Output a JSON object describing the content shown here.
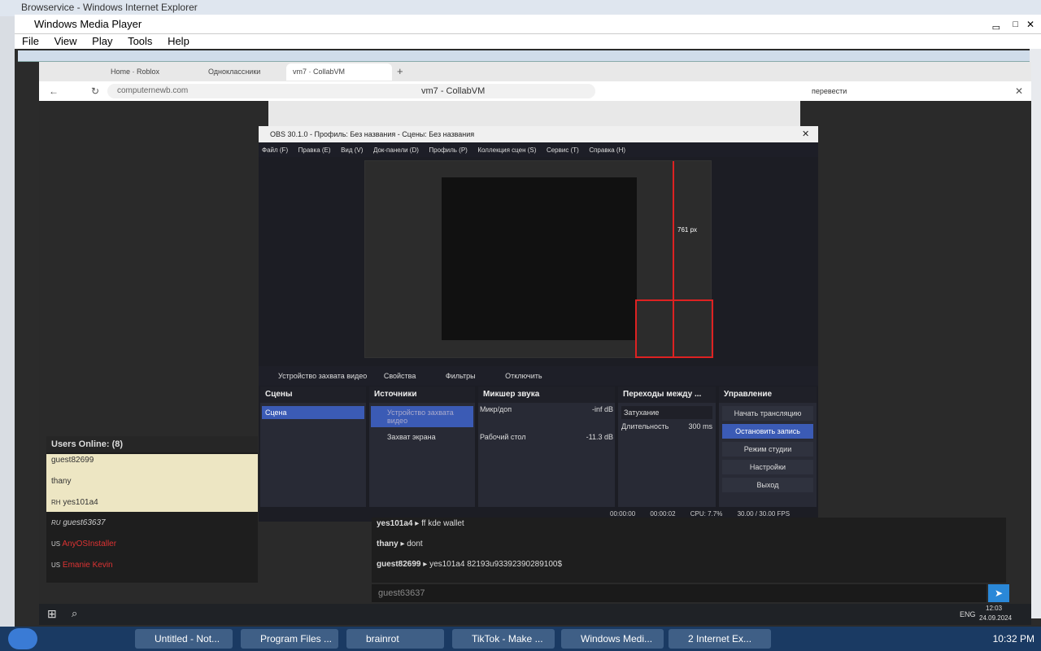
{
  "ie": {
    "title": "Browservice - Windows Internet Explorer"
  },
  "wmp": {
    "title": "Windows Media Player",
    "menu": [
      "File",
      "View",
      "Play",
      "Tools",
      "Help"
    ]
  },
  "browser": {
    "tabs": [
      {
        "label": "Home · Roblox"
      },
      {
        "label": "Одноклассники"
      },
      {
        "label": "vm7 · CollabVM"
      }
    ],
    "url": "computernewb.com",
    "page_title": "vm7 - CollabVM",
    "translate": "перевести"
  },
  "obs": {
    "title": "OBS 30.1.0 - Профиль: Без названия - Сцены: Без названия",
    "menu": [
      "Файл (F)",
      "Правка (E)",
      "Вид (V)",
      "Док-панели (D)",
      "Профиль (P)",
      "Коллекция сцен (S)",
      "Сервис (T)",
      "Справка (H)"
    ],
    "preview_label": "761 px",
    "source_bar": {
      "device": "Устройство захвата видео",
      "properties": "Свойства",
      "filters": "Фильтры",
      "disable": "Отключить"
    },
    "scenes": {
      "title": "Сцены",
      "items": [
        "Сцена"
      ]
    },
    "sources": {
      "title": "Источники",
      "items": [
        "Устройство захвата видео",
        "Захват экрана"
      ]
    },
    "mixer": {
      "title": "Микшер звука",
      "tracks": [
        {
          "name": "Микр/доп",
          "db": "-inf dB"
        },
        {
          "name": "Рабочий стол",
          "db": "-11.3 dB"
        }
      ]
    },
    "transitions": {
      "title": "Переходы между ...",
      "type": "Затухание",
      "duration_label": "Длительность",
      "duration": "300 ms"
    },
    "controls": {
      "title": "Управление",
      "buttons": [
        "Начать трансляцию",
        "Остановить запись",
        "Режим студии",
        "Настройки",
        "Выход"
      ]
    },
    "status": {
      "time1": "00:00:00",
      "time2": "00:00:02",
      "cpu": "CPU: 7.7%",
      "fps": "30.00 / 30.00 FPS"
    }
  },
  "users": {
    "header": "Users Online: (8)",
    "list": [
      {
        "name": "guest82699",
        "flag": ""
      },
      {
        "name": "thany",
        "flag": ""
      },
      {
        "name": "yes101a4",
        "flag": "RH"
      },
      {
        "name": "guest63637",
        "flag": "RU"
      },
      {
        "name": "AnyOSInstaller",
        "flag": "US"
      },
      {
        "name": "Emanie Kevin",
        "flag": "US"
      }
    ]
  },
  "chat": {
    "messages": [
      {
        "user": "yes101a4",
        "text": "ff kde wallet"
      },
      {
        "user": "thany",
        "text": "dont"
      },
      {
        "user": "guest82699",
        "text": "yes101a4 82193u93392390289100$"
      }
    ],
    "input_placeholder": "guest63637"
  },
  "vm_tray": {
    "lang": "ENG",
    "time": "12:03",
    "date": "24.09.2024"
  },
  "taskbar": {
    "items": [
      "Untitled - Not...",
      "Program Files ...",
      "brainrot",
      "TikTok - Make ...",
      "Windows Medi...",
      "2 Internet Ex..."
    ],
    "clock": "10:32 PM"
  }
}
